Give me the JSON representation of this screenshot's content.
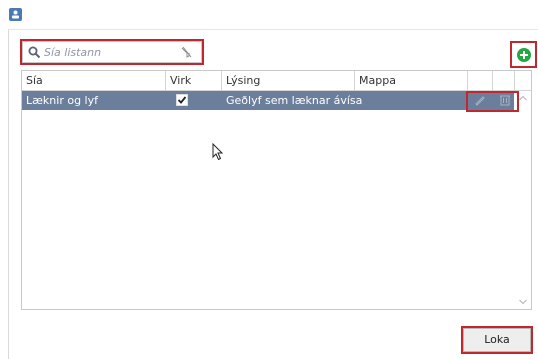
{
  "window": {
    "icon": "contact-card-icon"
  },
  "search": {
    "placeholder": "Sía listann",
    "search_icon": "search-icon",
    "clear_icon": "clear-filter-icon"
  },
  "toolbar": {
    "add_icon": "add-circle-icon",
    "accent": "#27a644"
  },
  "grid": {
    "columns": [
      "Sía",
      "Virk",
      "Lýsing",
      "Mappa"
    ],
    "rows": [
      {
        "sia": "Læknir og lyf",
        "virk": true,
        "lysing": "Geðlyf sem læknar ávísa",
        "mappa": ""
      }
    ],
    "selected_row_color": "#6b7f9c",
    "row_actions": [
      "edit-icon",
      "delete-icon"
    ]
  },
  "footer": {
    "close_label": "Loka"
  },
  "highlight_color": "#c0282d"
}
